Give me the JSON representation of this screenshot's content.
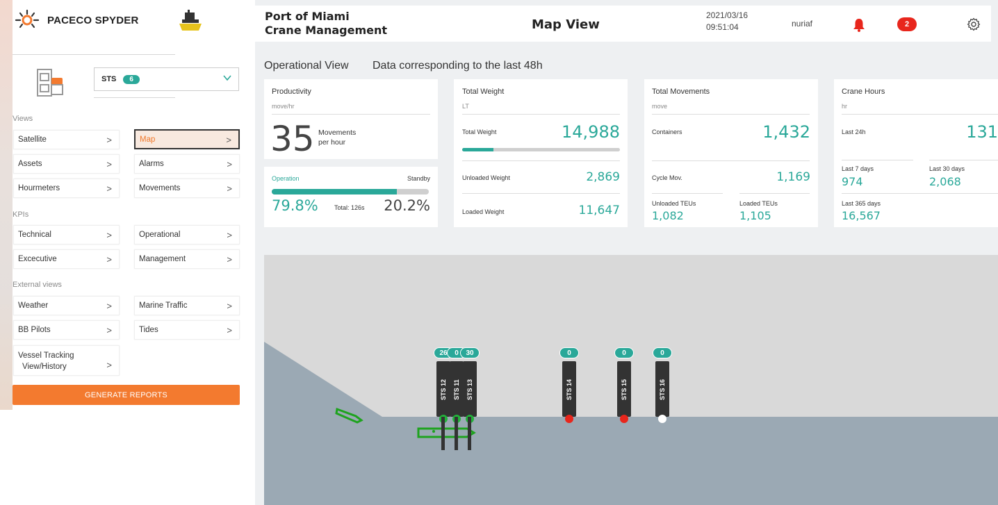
{
  "app": {
    "name": "PACECO SPYDER"
  },
  "sidebar": {
    "selector": {
      "label": "STS",
      "count": "6"
    },
    "sections": {
      "views": "Views",
      "kpis": "KPIs",
      "external": "External views"
    },
    "buttons": {
      "satellite": "Satellite",
      "map": "Map",
      "assets": "Assets",
      "alarms": "Alarms",
      "hourmeters": "Hourmeters",
      "movements": "Movements",
      "technical": "Technical",
      "operational": "Operational",
      "executive": "Excecutive",
      "management": "Management",
      "weather": "Weather",
      "marine_traffic": "Marine Traffic",
      "bb_pilots": "BB Pilots",
      "tides": "Tides",
      "vessel_tracking_1": "Vessel Tracking",
      "vessel_tracking_2": "View/History"
    },
    "arrow": ">",
    "generate": "GENERATE REPORTS"
  },
  "header": {
    "port_line1": "Port of Miami",
    "port_line2": "Crane Management",
    "title": "Map View",
    "date": "2021/03/16",
    "time": "09:51:04",
    "user": "nuriaf",
    "notifications": "2"
  },
  "overview": {
    "title": "Operational View",
    "subtitle": "Data corresponding to the last 48h"
  },
  "productivity": {
    "title": "Productivity",
    "unit": "move/hr",
    "value": "35",
    "desc1": "Movements",
    "desc2": "per hour",
    "operation_label": "Operation",
    "standby_label": "Standby",
    "operation_pct": "79.8%",
    "standby_pct": "20.2%",
    "total": "Total: 126s",
    "operation_fraction": 0.798
  },
  "weight": {
    "title": "Total Weight",
    "unit": "LT",
    "total_label": "Total Weight",
    "total": "14,988",
    "total_fraction": 0.2,
    "unloaded_label": "Unloaded Weight",
    "unloaded": "2,869",
    "loaded_label": "Loaded Weight",
    "loaded": "11,647"
  },
  "movements": {
    "title": "Total Movements",
    "unit": "move",
    "containers_label": "Containers",
    "containers": "1,432",
    "cycle_label": "Cycle Mov.",
    "cycle": "1,169",
    "unloaded_teu_label": "Unloaded TEUs",
    "unloaded_teu": "1,082",
    "loaded_teu_label": "Loaded TEUs",
    "loaded_teu": "1,105"
  },
  "hours": {
    "title": "Crane Hours",
    "unit": "hr",
    "last24_label": "Last 24h",
    "last24": "131",
    "last7_label": "Last 7 days",
    "last7": "974",
    "last30_label": "Last 30 days",
    "last30": "2,068",
    "last365_label": "Last 365 days",
    "last365": "16,567"
  },
  "cranes": [
    {
      "name": "STS 12",
      "count": "26",
      "status_color": "#22b33a"
    },
    {
      "name": "STS 11",
      "count": "0",
      "status_color": "#22b33a"
    },
    {
      "name": "STS 13",
      "count": "30",
      "status_color": "#22b33a"
    },
    {
      "name": "STS 14",
      "count": "0",
      "status_color": "#e8261c"
    },
    {
      "name": "STS 15",
      "count": "0",
      "status_color": "#e8261c"
    },
    {
      "name": "STS 16",
      "count": "0",
      "status_color": "#ffffff"
    }
  ],
  "colors": {
    "accent": "#2aa899",
    "orange": "#f37a2f",
    "alert": "#e8261c"
  }
}
